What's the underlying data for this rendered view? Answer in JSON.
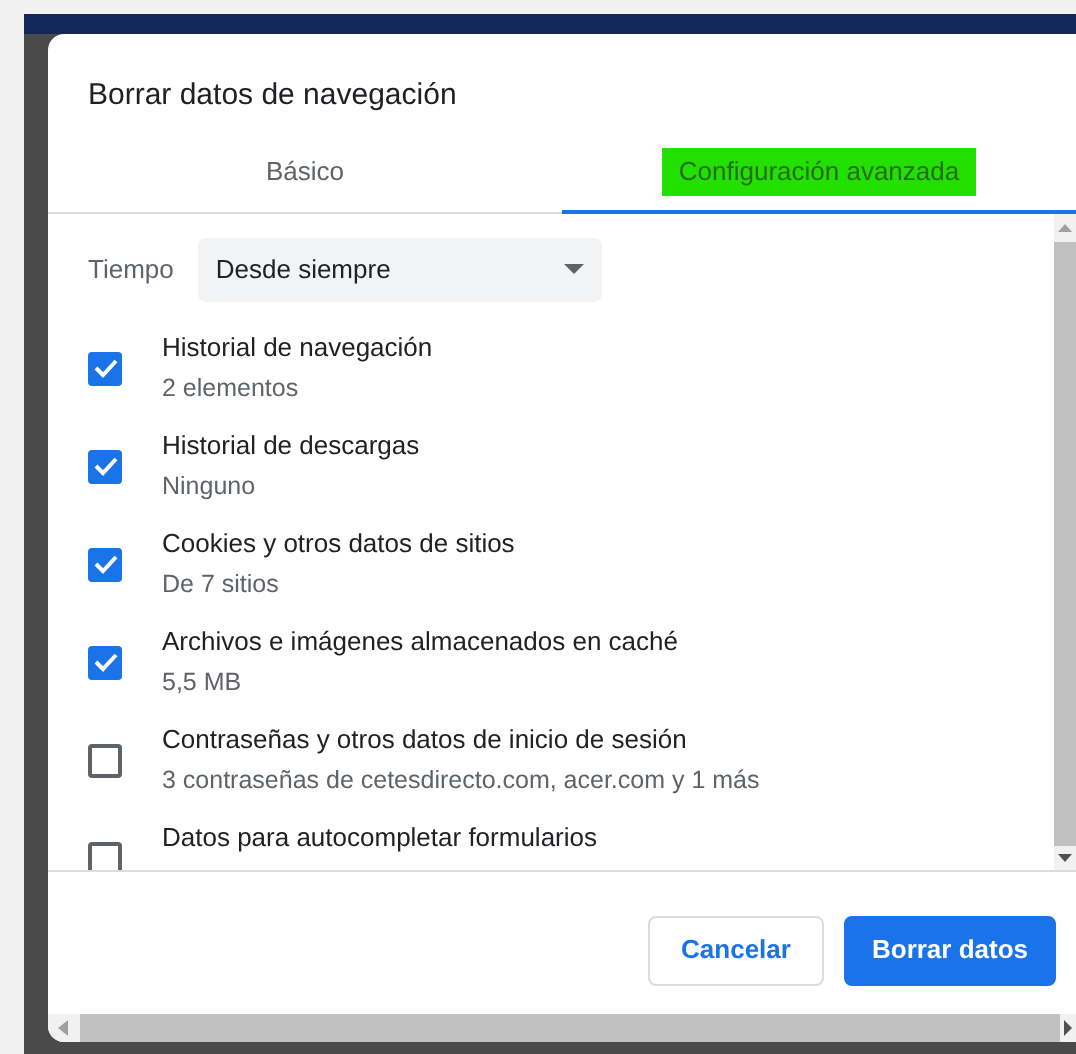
{
  "dialog": {
    "title": "Borrar datos de navegación"
  },
  "tabs": [
    {
      "label": "Básico",
      "selected": false,
      "highlighted": false
    },
    {
      "label": "Configuración avanzada",
      "selected": true,
      "highlighted": true
    }
  ],
  "time_range": {
    "label": "Tiempo",
    "value": "Desde siempre"
  },
  "items": [
    {
      "title": "Historial de navegación",
      "detail": "2 elementos",
      "checked": true
    },
    {
      "title": "Historial de descargas",
      "detail": "Ninguno",
      "checked": true
    },
    {
      "title": "Cookies y otros datos de sitios",
      "detail": "De 7 sitios",
      "checked": true
    },
    {
      "title": "Archivos e imágenes almacenados en caché",
      "detail": "5,5 MB",
      "checked": true
    },
    {
      "title": "Contraseñas y otros datos de inicio de sesión",
      "detail": "3 contraseñas de cetesdirecto.com, acer.com y 1 más",
      "checked": false
    },
    {
      "title": "Datos para autocompletar formularios",
      "checked": false
    }
  ],
  "buttons": [
    {
      "label": "Cancelar",
      "kind": "secondary"
    },
    {
      "label": "Borrar datos",
      "kind": "primary"
    }
  ]
}
